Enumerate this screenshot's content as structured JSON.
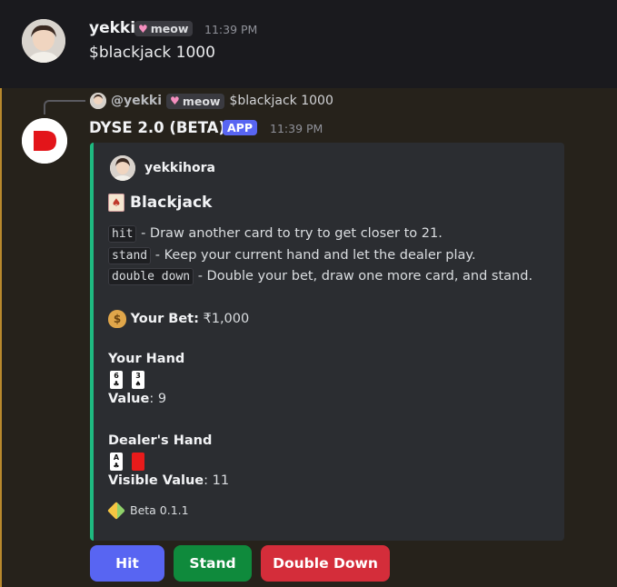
{
  "message1": {
    "username": "yekki",
    "tag": "meow",
    "time": "11:39 PM",
    "content": "$blackjack 1000"
  },
  "reply": {
    "username": "@yekki",
    "tag": "meow",
    "content": "$blackjack 1000"
  },
  "bot": {
    "name": "DYSE 2.0 (BETA)",
    "badge": "APP",
    "time": "11:39 PM"
  },
  "embed": {
    "author": "yekkihora",
    "title": "Blackjack",
    "commands": [
      {
        "code": "hit",
        "desc": " - Draw another card to try to get closer to 21."
      },
      {
        "code": "stand",
        "desc": " - Keep your current hand and let the dealer play."
      },
      {
        "code": "double down",
        "desc": " - Double your bet, draw one more card, and stand."
      }
    ],
    "bet_label": "Your Bet:",
    "bet_value": " ₹1,000",
    "your_hand_label": "Your Hand",
    "your_cards": [
      {
        "rank": "6",
        "suit": "♣"
      },
      {
        "rank": "3",
        "suit": "♠"
      }
    ],
    "your_value_label": "Value",
    "your_value": ": 9",
    "dealer_hand_label": "Dealer's Hand",
    "dealer_cards": [
      {
        "rank": "A",
        "suit": "♣"
      }
    ],
    "visible_value_label": "Visible Value",
    "visible_value": ": 11",
    "footer": "Beta 0.1.1"
  },
  "buttons": {
    "hit": "Hit",
    "stand": "Stand",
    "double_down": "Double Down"
  },
  "colors": {
    "embed_accent": "#1eb980",
    "hit": "#5865f2",
    "stand": "#0f8a3c",
    "double_down": "#d42d3a",
    "mention_bar": "#b8892d"
  }
}
